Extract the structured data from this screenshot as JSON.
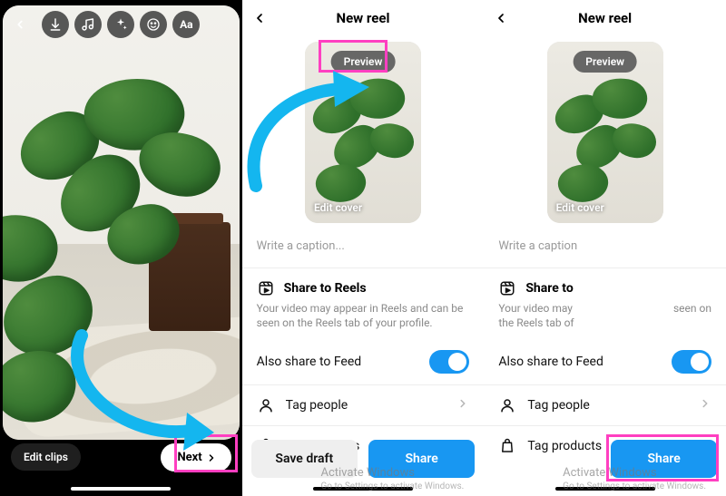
{
  "panel1": {
    "edit_clips_label": "Edit clips",
    "next_label": "Next",
    "icons": [
      "download-icon",
      "music-icon",
      "sparkle-icon",
      "sticker-icon",
      "text-icon"
    ]
  },
  "panel2": {
    "title": "New reel",
    "preview_label": "Preview",
    "edit_cover_label": "Edit cover",
    "caption_placeholder": "Write a caption...",
    "share_header": "Share to Reels",
    "share_sub": "Your video may appear in Reels and can be seen on the Reels tab of your profile.",
    "also_share_label": "Also share to Feed",
    "tag_people_label": "Tag people",
    "tag_products_label": "Tag products",
    "save_draft_label": "Save draft",
    "share_btn_label": "Share",
    "watermark_title": "Activate Windows",
    "watermark_sub": "Go to Settings to activate Windows."
  },
  "panel3": {
    "title": "New reel",
    "preview_label": "Preview",
    "edit_cover_label": "Edit cover",
    "caption_placeholder": "Write a caption",
    "share_header": "Share to",
    "share_sub_left": "Your video may",
    "share_sub_right": "seen on",
    "share_sub_line2": "the Reels tab of",
    "also_share_label": "Also share to Feed",
    "tag_people_label": "Tag people",
    "tag_products_label": "Tag products",
    "share_btn_label": "Share",
    "watermark_title": "Activate Windows",
    "watermark_sub": "Go to Settings to activate Windows."
  },
  "colors": {
    "accent_blue": "#1897f2",
    "highlight_pink": "#ff3fc1"
  }
}
